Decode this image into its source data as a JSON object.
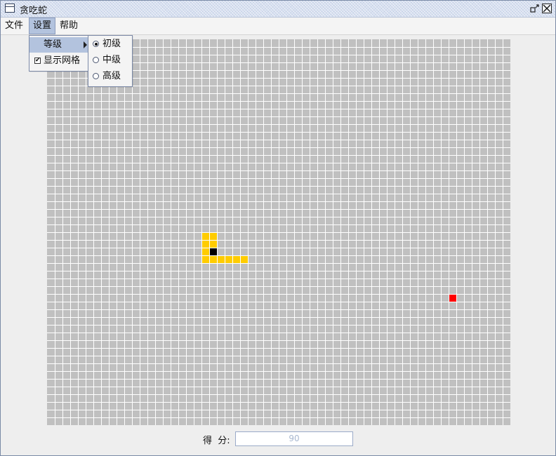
{
  "window": {
    "title": "贪吃蛇"
  },
  "menubar": {
    "items": [
      {
        "label": "文件",
        "active": false
      },
      {
        "label": "设置",
        "active": true
      },
      {
        "label": "帮助",
        "active": false
      }
    ]
  },
  "settings_menu": {
    "level_label": "等级",
    "show_grid_label": "显示网格",
    "show_grid_checked": true,
    "check_glyph": "✔"
  },
  "level_submenu": {
    "options": [
      {
        "label": "初级",
        "selected": true
      },
      {
        "label": "中级",
        "selected": false
      },
      {
        "label": "高级",
        "selected": false
      }
    ]
  },
  "board": {
    "cols": 60,
    "rows": 50,
    "show_grid": true,
    "colors": {
      "cell": "#c0c0c0",
      "grid_line": "#ffffff",
      "snake_body": "#ffcc00",
      "snake_head": "#000000",
      "food": "#ff0000"
    },
    "snake": {
      "head": [
        21,
        27
      ],
      "body": [
        [
          20,
          25
        ],
        [
          21,
          25
        ],
        [
          20,
          26
        ],
        [
          21,
          26
        ],
        [
          20,
          27
        ],
        [
          20,
          28
        ],
        [
          21,
          28
        ],
        [
          22,
          28
        ],
        [
          23,
          28
        ],
        [
          24,
          28
        ],
        [
          25,
          28
        ]
      ]
    },
    "food": [
      52,
      33
    ]
  },
  "score": {
    "label": "得  分:",
    "value": "90"
  },
  "icons": {
    "app": "window-icon",
    "restore": "restore-icon",
    "close": "close-icon",
    "submenu": "chevron-right-icon"
  }
}
